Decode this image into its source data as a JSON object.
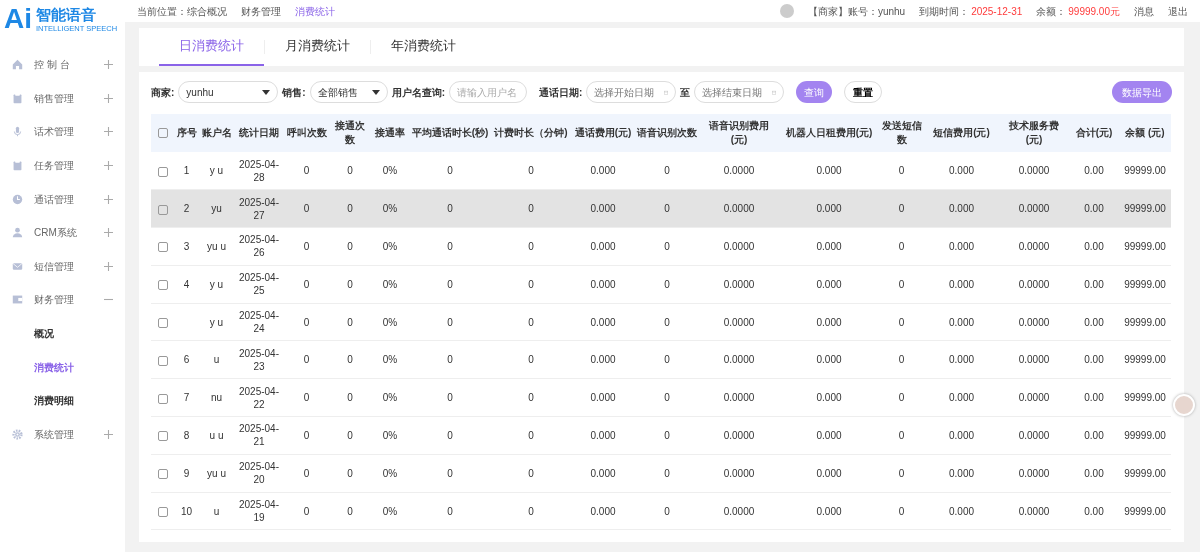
{
  "logo": {
    "mark": "Ai",
    "title": "智能语音",
    "subtitle": "INTELLIGENT SPEECH"
  },
  "sidebar": {
    "items": [
      {
        "label": "控 制 台",
        "expanded": false
      },
      {
        "label": "销售管理",
        "expanded": false
      },
      {
        "label": "话术管理",
        "expanded": false
      },
      {
        "label": "任务管理",
        "expanded": false
      },
      {
        "label": "通话管理",
        "expanded": false
      },
      {
        "label": "CRM系统",
        "expanded": false
      },
      {
        "label": "短信管理",
        "expanded": false
      },
      {
        "label": "财务管理",
        "expanded": true,
        "children": [
          {
            "label": "概况",
            "selected": false
          },
          {
            "label": "消费统计",
            "selected": true
          },
          {
            "label": "消费明细",
            "selected": false
          }
        ]
      },
      {
        "label": "系统管理",
        "expanded": false
      }
    ]
  },
  "header": {
    "breadcrumb": [
      "当前位置：综合概况",
      "财务管理",
      "消费统计"
    ],
    "account": "【商家】账号：yunhu",
    "expiry_label": "到期时间：",
    "expiry": "2025-12-31",
    "balance_label": "余额：",
    "balance": "99999.00元",
    "messages": "消息",
    "logout": "退出"
  },
  "tabs": [
    {
      "label": "日消费统计",
      "selected": true
    },
    {
      "label": "月消费统计",
      "selected": false
    },
    {
      "label": "年消费统计",
      "selected": false
    }
  ],
  "filters": {
    "merchant_label": "商家:",
    "merchant": "yunhu",
    "sales_label": "销售:",
    "sales": "全部销售",
    "user_label": "用户名查询:",
    "user_placeholder": "请输入用户名",
    "date_label": "通话日期:",
    "start_placeholder": "选择开始日期",
    "to": "至",
    "end_placeholder": "选择结束日期",
    "search": "查询",
    "reset": "重置",
    "export": "数据导出"
  },
  "table": {
    "all_checked": false,
    "columns": [
      "序号",
      "账户名",
      "统计日期",
      "呼叫次数",
      "接通次数",
      "接通率",
      "平均通话时长(秒)",
      "计费时长（分钟)",
      "通话费用(元)",
      "语音识别次数",
      "语音识别费用(元)",
      "机器人日租费用(元)",
      "发送短信数",
      "短信费用(元)",
      "技术服务费(元)",
      "合计(元)",
      "余额 (元)"
    ],
    "rows": [
      {
        "checked": false,
        "highlighted": false,
        "cells": [
          "1",
          "y u",
          "2025-04-28",
          "0",
          "0",
          "0%",
          "0",
          "0",
          "0.000",
          "0",
          "0.0000",
          "0.000",
          "0",
          "0.000",
          "0.0000",
          "0.00",
          "99999.00"
        ]
      },
      {
        "checked": false,
        "highlighted": true,
        "cells": [
          "2",
          "yu",
          "2025-04-27",
          "0",
          "0",
          "0%",
          "0",
          "0",
          "0.000",
          "0",
          "0.0000",
          "0.000",
          "0",
          "0.000",
          "0.0000",
          "0.00",
          "99999.00"
        ]
      },
      {
        "checked": false,
        "highlighted": false,
        "cells": [
          "3",
          "yu u",
          "2025-04-26",
          "0",
          "0",
          "0%",
          "0",
          "0",
          "0.000",
          "0",
          "0.0000",
          "0.000",
          "0",
          "0.000",
          "0.0000",
          "0.00",
          "99999.00"
        ]
      },
      {
        "checked": false,
        "highlighted": false,
        "cells": [
          "4",
          "y u",
          "2025-04-25",
          "0",
          "0",
          "0%",
          "0",
          "0",
          "0.000",
          "0",
          "0.0000",
          "0.000",
          "0",
          "0.000",
          "0.0000",
          "0.00",
          "99999.00"
        ]
      },
      {
        "checked": false,
        "highlighted": false,
        "cells": [
          "",
          "y u",
          "2025-04-24",
          "0",
          "0",
          "0%",
          "0",
          "0",
          "0.000",
          "0",
          "0.0000",
          "0.000",
          "0",
          "0.000",
          "0.0000",
          "0.00",
          "99999.00"
        ]
      },
      {
        "checked": false,
        "highlighted": false,
        "cells": [
          "6",
          "u",
          "2025-04-23",
          "0",
          "0",
          "0%",
          "0",
          "0",
          "0.000",
          "0",
          "0.0000",
          "0.000",
          "0",
          "0.000",
          "0.0000",
          "0.00",
          "99999.00"
        ]
      },
      {
        "checked": false,
        "highlighted": false,
        "cells": [
          "7",
          "nu",
          "2025-04-22",
          "0",
          "0",
          "0%",
          "0",
          "0",
          "0.000",
          "0",
          "0.0000",
          "0.000",
          "0",
          "0.000",
          "0.0000",
          "0.00",
          "99999.00"
        ]
      },
      {
        "checked": false,
        "highlighted": false,
        "cells": [
          "8",
          "u u",
          "2025-04-21",
          "0",
          "0",
          "0%",
          "0",
          "0",
          "0.000",
          "0",
          "0.0000",
          "0.000",
          "0",
          "0.000",
          "0.0000",
          "0.00",
          "99999.00"
        ]
      },
      {
        "checked": false,
        "highlighted": false,
        "cells": [
          "9",
          "yu u",
          "2025-04-20",
          "0",
          "0",
          "0%",
          "0",
          "0",
          "0.000",
          "0",
          "0.0000",
          "0.000",
          "0",
          "0.000",
          "0.0000",
          "0.00",
          "99999.00"
        ]
      },
      {
        "checked": false,
        "highlighted": false,
        "cells": [
          "10",
          "u",
          "2025-04-19",
          "0",
          "0",
          "0%",
          "0",
          "0",
          "0.000",
          "0",
          "0.0000",
          "0.000",
          "0",
          "0.000",
          "0.0000",
          "0.00",
          "99999.00"
        ]
      }
    ]
  }
}
